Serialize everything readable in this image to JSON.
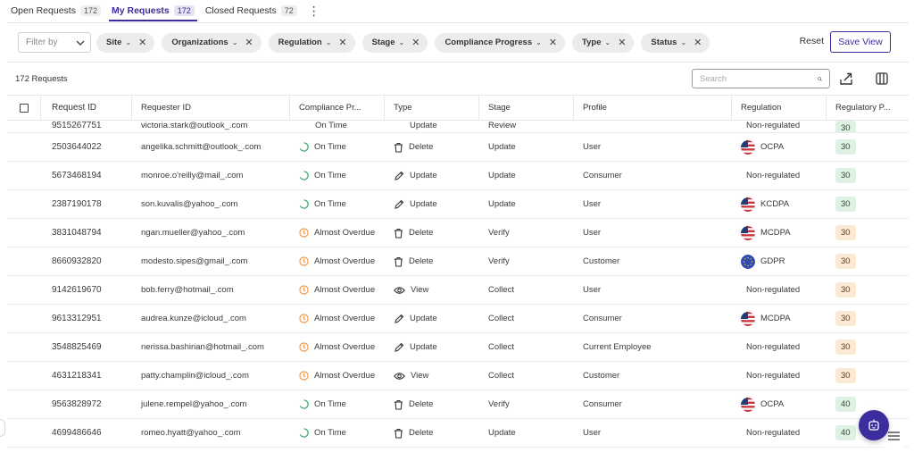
{
  "tabs": [
    {
      "label": "Open Requests",
      "count": "172"
    },
    {
      "label": "My Requests",
      "count": "172"
    },
    {
      "label": "Closed Requests",
      "count": "72"
    }
  ],
  "filters": {
    "filter_by_placeholder": "Filter by",
    "chips": [
      "Site",
      "Organizations",
      "Regulation",
      "Stage",
      "Compliance Progress",
      "Type",
      "Status"
    ],
    "reset_label": "Reset",
    "save_view_label": "Save View"
  },
  "toolbar": {
    "request_count": "172 Requests",
    "search_placeholder": "Search"
  },
  "table": {
    "headers": [
      "Request ID",
      "Requester ID",
      "Compliance Pr...",
      "Type",
      "Stage",
      "Profile",
      "Regulation",
      "Regulatory P..."
    ],
    "partial_top": {
      "request_id": "9515267751",
      "requester": "victoria.stark@outlook_.com",
      "status": "On Time",
      "type": "Update",
      "stage": "Review",
      "profile": "",
      "regulation": "Non-regulated",
      "days": "30"
    },
    "rows": [
      {
        "request_id": "2503644022",
        "requester": "angelika.schmitt@outlook_.com",
        "status": "On Time",
        "status_kind": "ontime",
        "type": "Delete",
        "type_icon": "trash-icon",
        "stage": "Update",
        "profile": "User",
        "regulation": "OCPA",
        "flag": "us-flag-icon",
        "days": "30",
        "days_color": "green"
      },
      {
        "request_id": "5673468194",
        "requester": "monroe.o'reilly@mail_.com",
        "status": "On Time",
        "status_kind": "ontime",
        "type": "Update",
        "type_icon": "pencil-icon",
        "stage": "Update",
        "profile": "Consumer",
        "regulation": "Non-regulated",
        "flag": "",
        "days": "30",
        "days_color": "green"
      },
      {
        "request_id": "2387190178",
        "requester": "son.kuvalis@yahoo_.com",
        "status": "On Time",
        "status_kind": "ontime",
        "type": "Update",
        "type_icon": "pencil-icon",
        "stage": "Update",
        "profile": "User",
        "regulation": "KCDPA",
        "flag": "us-flag-icon",
        "days": "30",
        "days_color": "green"
      },
      {
        "request_id": "3831048794",
        "requester": "ngan.mueller@yahoo_.com",
        "status": "Almost Overdue",
        "status_kind": "almost",
        "type": "Delete",
        "type_icon": "trash-icon",
        "stage": "Verify",
        "profile": "User",
        "regulation": "MCDPA",
        "flag": "us-flag-icon",
        "days": "30",
        "days_color": "orange"
      },
      {
        "request_id": "8660932820",
        "requester": "modesto.sipes@gmail_.com",
        "status": "Almost Overdue",
        "status_kind": "almost",
        "type": "Delete",
        "type_icon": "trash-icon",
        "stage": "Verify",
        "profile": "Customer",
        "regulation": "GDPR",
        "flag": "eu-flag-icon",
        "days": "30",
        "days_color": "orange"
      },
      {
        "request_id": "9142619670",
        "requester": "bob.ferry@hotmail_.com",
        "status": "Almost Overdue",
        "status_kind": "almost",
        "type": "View",
        "type_icon": "eye-icon",
        "stage": "Collect",
        "profile": "User",
        "regulation": "Non-regulated",
        "flag": "",
        "days": "30",
        "days_color": "orange"
      },
      {
        "request_id": "9613312951",
        "requester": "audrea.kunze@icloud_.com",
        "status": "Almost Overdue",
        "status_kind": "almost",
        "type": "Update",
        "type_icon": "pencil-icon",
        "stage": "Collect",
        "profile": "Consumer",
        "regulation": "MCDPA",
        "flag": "us-flag-icon",
        "days": "30",
        "days_color": "orange"
      },
      {
        "request_id": "3548825469",
        "requester": "nerissa.bashirian@hotmail_.com",
        "status": "Almost Overdue",
        "status_kind": "almost",
        "type": "Update",
        "type_icon": "pencil-icon",
        "stage": "Collect",
        "profile": "Current Employee",
        "regulation": "Non-regulated",
        "flag": "",
        "days": "30",
        "days_color": "orange"
      },
      {
        "request_id": "4631218341",
        "requester": "patty.champlin@icloud_.com",
        "status": "Almost Overdue",
        "status_kind": "almost",
        "type": "View",
        "type_icon": "eye-icon",
        "stage": "Collect",
        "profile": "Customer",
        "regulation": "Non-regulated",
        "flag": "",
        "days": "30",
        "days_color": "orange"
      },
      {
        "request_id": "9563828972",
        "requester": "julene.rempel@yahoo_.com",
        "status": "On Time",
        "status_kind": "ontime",
        "type": "Delete",
        "type_icon": "trash-icon",
        "stage": "Verify",
        "profile": "Consumer",
        "regulation": "OCPA",
        "flag": "us-flag-icon",
        "days": "40",
        "days_color": "green"
      },
      {
        "request_id": "4699486646",
        "requester": "romeo.hyatt@yahoo_.com",
        "status": "On Time",
        "status_kind": "ontime",
        "type": "Delete",
        "type_icon": "trash-icon",
        "stage": "Update",
        "profile": "User",
        "regulation": "Non-regulated",
        "flag": "",
        "days": "40",
        "days_color": "green"
      }
    ]
  },
  "colors": {
    "accent": "#3b2d9e",
    "ontime": "#3aa66a",
    "almost": "#f0913a",
    "badge_green": "#dff0e4",
    "badge_orange": "#fbe9d6"
  }
}
